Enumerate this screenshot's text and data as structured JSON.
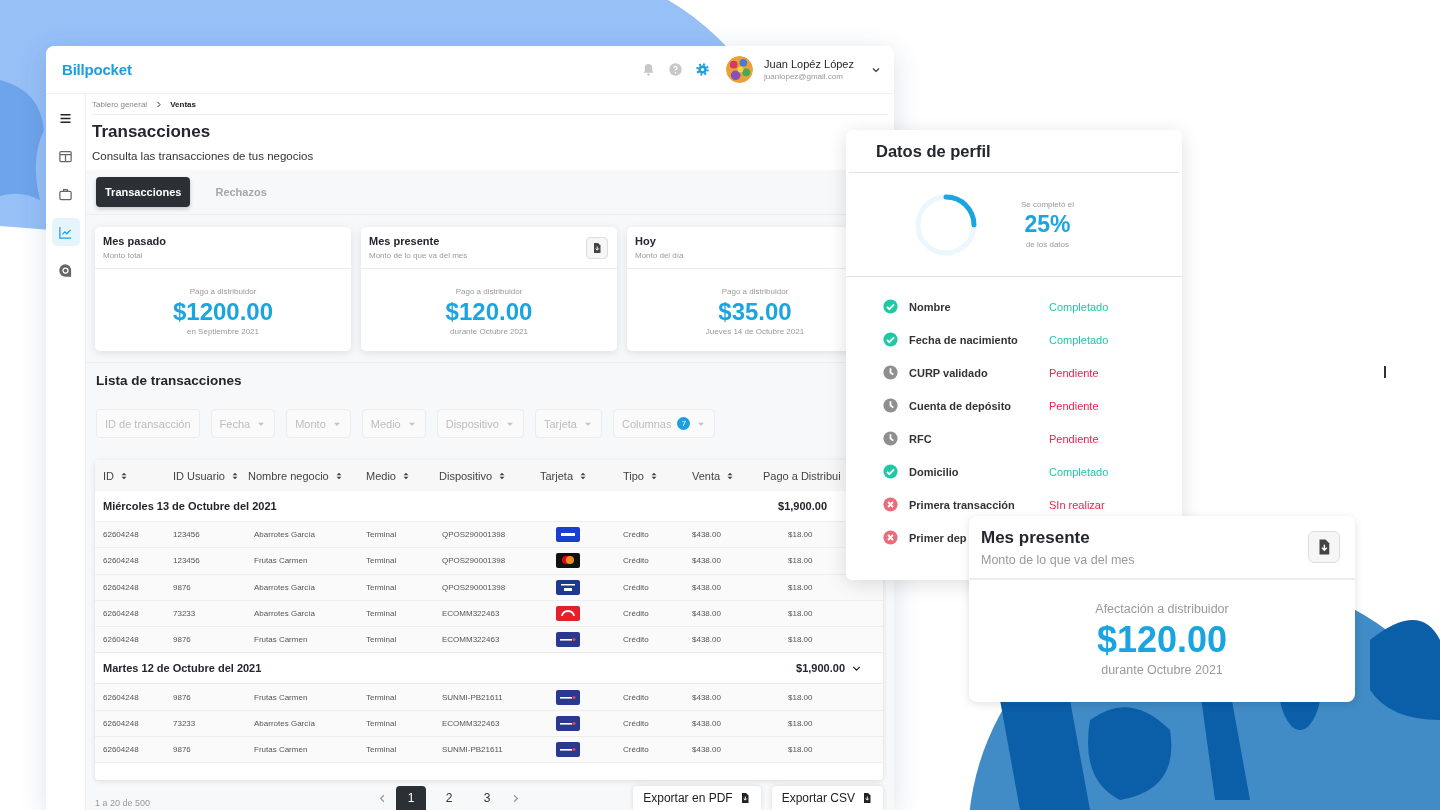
{
  "app": {
    "logo": "Billpocket",
    "user": {
      "name": "Juan Lopéz López",
      "email": "juanlopez@gmail.com"
    },
    "sidebar": [
      {
        "kind": "menu",
        "selected": false
      },
      {
        "kind": "layout",
        "selected": false
      },
      {
        "kind": "briefcase",
        "selected": false
      },
      {
        "kind": "chart",
        "selected": true
      },
      {
        "kind": "money",
        "selected": false
      }
    ],
    "breadcrumb": [
      "Tablero general",
      "Ventas"
    ],
    "title": "Transacciones",
    "subtitle": "Consulta las transacciones de tus negocios",
    "tabs": [
      {
        "label": "Transacciones",
        "selected": true
      },
      {
        "label": "Rechazos",
        "selected": false
      }
    ],
    "stat_cards": [
      {
        "title": "Mes pasado",
        "subtitle": "Monto total",
        "caption": "Pago a distribuidor",
        "amount": "$1200.00",
        "period": "en Septiembre 2021",
        "download": false
      },
      {
        "title": "Mes presente",
        "subtitle": "Monto de lo que va del mes",
        "caption": "Pago a distribuidor",
        "amount": "$120.00",
        "period": "durante Octubre 2021",
        "download": true
      },
      {
        "title": "Hoy",
        "subtitle": "Monto del día",
        "caption": "Pago a distribuidor",
        "amount": "$35.00",
        "period": "Jueves 14 de Octubre 2021",
        "download": false
      }
    ],
    "list_title": "Lista de transacciones",
    "filters": [
      {
        "label": "ID de transacción",
        "kind": "text"
      },
      {
        "label": "Fecha",
        "kind": "dropdown"
      },
      {
        "label": "Monto",
        "kind": "dropdown"
      },
      {
        "label": "Medio",
        "kind": "dropdown"
      },
      {
        "label": "Dispositivo",
        "kind": "dropdown"
      },
      {
        "label": "Tarjeta",
        "kind": "dropdown"
      },
      {
        "label": "Columnas",
        "kind": "dropdown",
        "badge": "7"
      }
    ],
    "table": {
      "columns": [
        "ID",
        "ID Usuario",
        "Nombre negocio",
        "Medio",
        "Dispositivo",
        "Tarjeta",
        "Tipo",
        "Venta",
        "Pago a Distribui"
      ],
      "groups": [
        {
          "date": "Miércoles 13 de Octubre del 2021",
          "total": "$1,900.00",
          "rows": [
            {
              "id": "62604248",
              "user_id": "123456",
              "business": "Abarrotes García",
              "medium": "Terminal",
              "device": "QPOS290001398",
              "kind": "visa",
              "type": "Crédito",
              "sale": "$438.00",
              "payout": "$18.00"
            },
            {
              "id": "62604248",
              "user_id": "123456",
              "business": "Frutas Carmen",
              "medium": "Terminal",
              "device": "QPOS290001398",
              "kind": "mastercard",
              "type": "Crédito",
              "sale": "$438.00",
              "payout": "$18.00"
            },
            {
              "id": "62604248",
              "user_id": "9876",
              "business": "Abarrotes García",
              "medium": "Terminal",
              "device": "QPOS290001398",
              "kind": "samsung",
              "type": "Crédito",
              "sale": "$438.00",
              "payout": "$18.00"
            },
            {
              "id": "62604248",
              "user_id": "73233",
              "business": "Abarrotes García",
              "medium": "Terminal",
              "device": "ECOMM322463",
              "kind": "carnet",
              "type": "Crédito",
              "sale": "$438.00",
              "payout": "$18.00"
            },
            {
              "id": "62604248",
              "user_id": "9876",
              "business": "Frutas Carmen",
              "medium": "Terminal",
              "device": "ECOMM322463",
              "kind": "sodexo",
              "type": "Crédito",
              "sale": "$438.00",
              "payout": "$18.00"
            }
          ]
        },
        {
          "date": "Martes 12 de Octubre del 2021",
          "total": "$1,900.00",
          "rows": [
            {
              "id": "62604248",
              "user_id": "9876",
              "business": "Frutas Carmen",
              "medium": "Terminal",
              "device": "SUNMI-PB21611",
              "kind": "sodexo",
              "type": "Crédito",
              "sale": "$438.00",
              "payout": "$18.00"
            },
            {
              "id": "62604248",
              "user_id": "73233",
              "business": "Abarrotes García",
              "medium": "Terminal",
              "device": "ECOMM322463",
              "kind": "sodexo",
              "type": "Crédito",
              "sale": "$438.00",
              "payout": "$18.00"
            },
            {
              "id": "62604248",
              "user_id": "9876",
              "business": "Frutas Carmen",
              "medium": "Terminal",
              "device": "SUNMI-PB21611",
              "kind": "sodexo",
              "type": "Crédito",
              "sale": "$438.00",
              "payout": "$18.00"
            }
          ]
        }
      ]
    },
    "pagination": {
      "summary": "1 a 20 de 500",
      "pages": [
        {
          "label": "1",
          "selected": true
        },
        {
          "label": "2",
          "selected": false
        },
        {
          "label": "3",
          "selected": false
        }
      ]
    },
    "exports": [
      "Exportar en PDF",
      "Exportar CSV"
    ]
  },
  "profile": {
    "title": "Datos de perfil",
    "progress_caption": "Se completó el",
    "percent": "25%",
    "progress_note": "de los datos",
    "level": 0.25,
    "items": [
      {
        "label": "Nombre",
        "kind": "done",
        "status": "Completado"
      },
      {
        "label": "Fecha de nacimiento",
        "kind": "done",
        "status": "Completado"
      },
      {
        "label": "CURP validado",
        "kind": "pending",
        "status": "Pendiente"
      },
      {
        "label": "Cuenta de depósito",
        "kind": "pending",
        "status": "Pendiente"
      },
      {
        "label": "RFC",
        "kind": "pending",
        "status": "Pendiente"
      },
      {
        "label": "Domicilio",
        "kind": "done",
        "status": "Completado"
      },
      {
        "label": "Primera transacción",
        "kind": "failed",
        "status": "SIn realizar"
      },
      {
        "label": "Primer dep",
        "kind": "failed"
      }
    ]
  },
  "month_card": {
    "title": "Mes presente",
    "subtitle": "Monto de lo que va del mes",
    "caption": "Afectación a distribuidor",
    "amount": "$120.00",
    "period": "durante Octubre 2021",
    "download": true
  }
}
